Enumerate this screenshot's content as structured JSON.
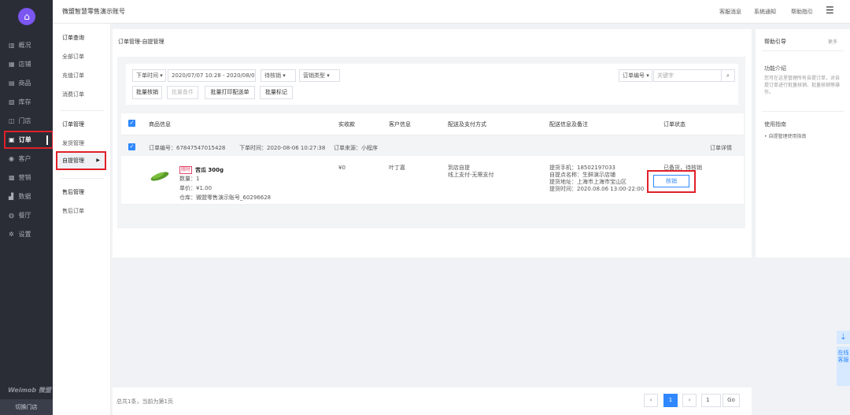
{
  "app": {
    "account_title": "微盟智慧零售演示账号",
    "brand": "Weimob 微盟",
    "switch_store": "切换门店"
  },
  "nav": [
    {
      "label": "概况",
      "icon": "chart-icon"
    },
    {
      "label": "店铺",
      "icon": "store-icon"
    },
    {
      "label": "商品",
      "icon": "goods-icon"
    },
    {
      "label": "库存",
      "icon": "inventory-icon"
    },
    {
      "label": "门店",
      "icon": "shop-icon"
    },
    {
      "label": "订单",
      "icon": "order-icon"
    },
    {
      "label": "客户",
      "icon": "customer-icon"
    },
    {
      "label": "营销",
      "icon": "marketing-icon"
    },
    {
      "label": "数据",
      "icon": "data-icon"
    },
    {
      "label": "餐厅",
      "icon": "restaurant-icon"
    },
    {
      "label": "设置",
      "icon": "settings-icon"
    }
  ],
  "top_links": [
    "客服消息",
    "系统通知",
    "帮助指引"
  ],
  "submenu": {
    "g1_head": "订单查询",
    "g1": [
      "全部订单",
      "充值订单",
      "消费订单"
    ],
    "g2_head": "订单管理",
    "g2": [
      "发货管理",
      "自提管理"
    ],
    "g3_head": "售后管理",
    "g3": [
      "售后订单"
    ]
  },
  "breadcrumb": "订单管理-自提管理",
  "filters": {
    "time_type": "下单时间",
    "date_range": "2020/07/07 10:28 - 2020/08/06",
    "status": "待核销",
    "sales_type": "营销类型",
    "order_no_select": "订单编号",
    "keyword_placeholder": "关键字",
    "btn_batch_verify": "批量核销",
    "btn_batch_ship": "批量备件",
    "btn_batch_print": "批量打印配送单",
    "btn_batch_mark": "批量标记"
  },
  "table": {
    "headers": [
      "商品信息",
      "实收款",
      "客户信息",
      "配送及支付方式",
      "配送信息及备注",
      "订单状态"
    ],
    "order": {
      "order_no": "订单编号：67847547015428",
      "order_time": "下单时间：2020-08-06 10:27:38",
      "source": "订单来源：小程序",
      "detail": "订单详情",
      "tag": "限时",
      "product": "苦瓜 300g",
      "qty": "数量：1",
      "price": "单价：¥1.00",
      "warehouse": "仓库：微盟零售演示账号_60296628",
      "paid": "¥0",
      "customer": "叶丁嘉",
      "delivery1": "到店自提",
      "delivery2": "线上支付-无需支付",
      "info": [
        "提货手机：18502197033",
        "自提点名称：生鲜演示店铺",
        "提货地址：上海市上海市宝山区",
        "提货时间：2020.08.06 13:00-22:00"
      ],
      "status": "已备货，待核销",
      "verify_btn": "核销"
    }
  },
  "right": {
    "title": "帮助引导",
    "more": "更多",
    "func_title": "功能介绍",
    "func_desc": "您可在这里管理所有自提订单，对自提订单进行批量核销、批量核销等操作。",
    "guide_title": "使用指南",
    "guide_item": "• 自提管理使用指南"
  },
  "pagination": {
    "info": "总共1条，当前为第1页",
    "prev": "‹",
    "current": "1",
    "next": "›",
    "jump": "1",
    "go": "Go"
  },
  "float": {
    "download": "⇣",
    "online": "在线客服"
  }
}
